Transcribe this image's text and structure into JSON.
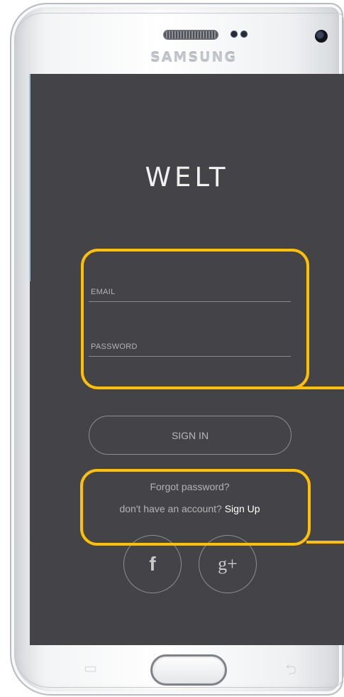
{
  "device": {
    "brand": "SAMSUNG"
  },
  "app": {
    "logo_text": "WELT"
  },
  "login_form": {
    "email_placeholder": "EMAIL",
    "email_value": "",
    "password_placeholder": "PASSWORD",
    "password_value": ""
  },
  "actions": {
    "signin_label": "SIGN IN",
    "forgot_password_label": "Forgot password?",
    "no_account_text": "don't have an account?",
    "signup_label": "Sign Up"
  },
  "social": [
    {
      "name": "facebook",
      "glyph": "f",
      "icon": "facebook-icon"
    },
    {
      "name": "google-plus",
      "glyph": "g+",
      "icon": "google-plus-icon"
    }
  ],
  "navigation": {
    "recent_apps_icon": "recent-apps-icon",
    "back_icon": "back-icon"
  },
  "colors": {
    "screen_background": "#444448",
    "highlight": "#ffc000",
    "text_muted": "#b3b3b6",
    "text_bright": "#ffffff"
  }
}
